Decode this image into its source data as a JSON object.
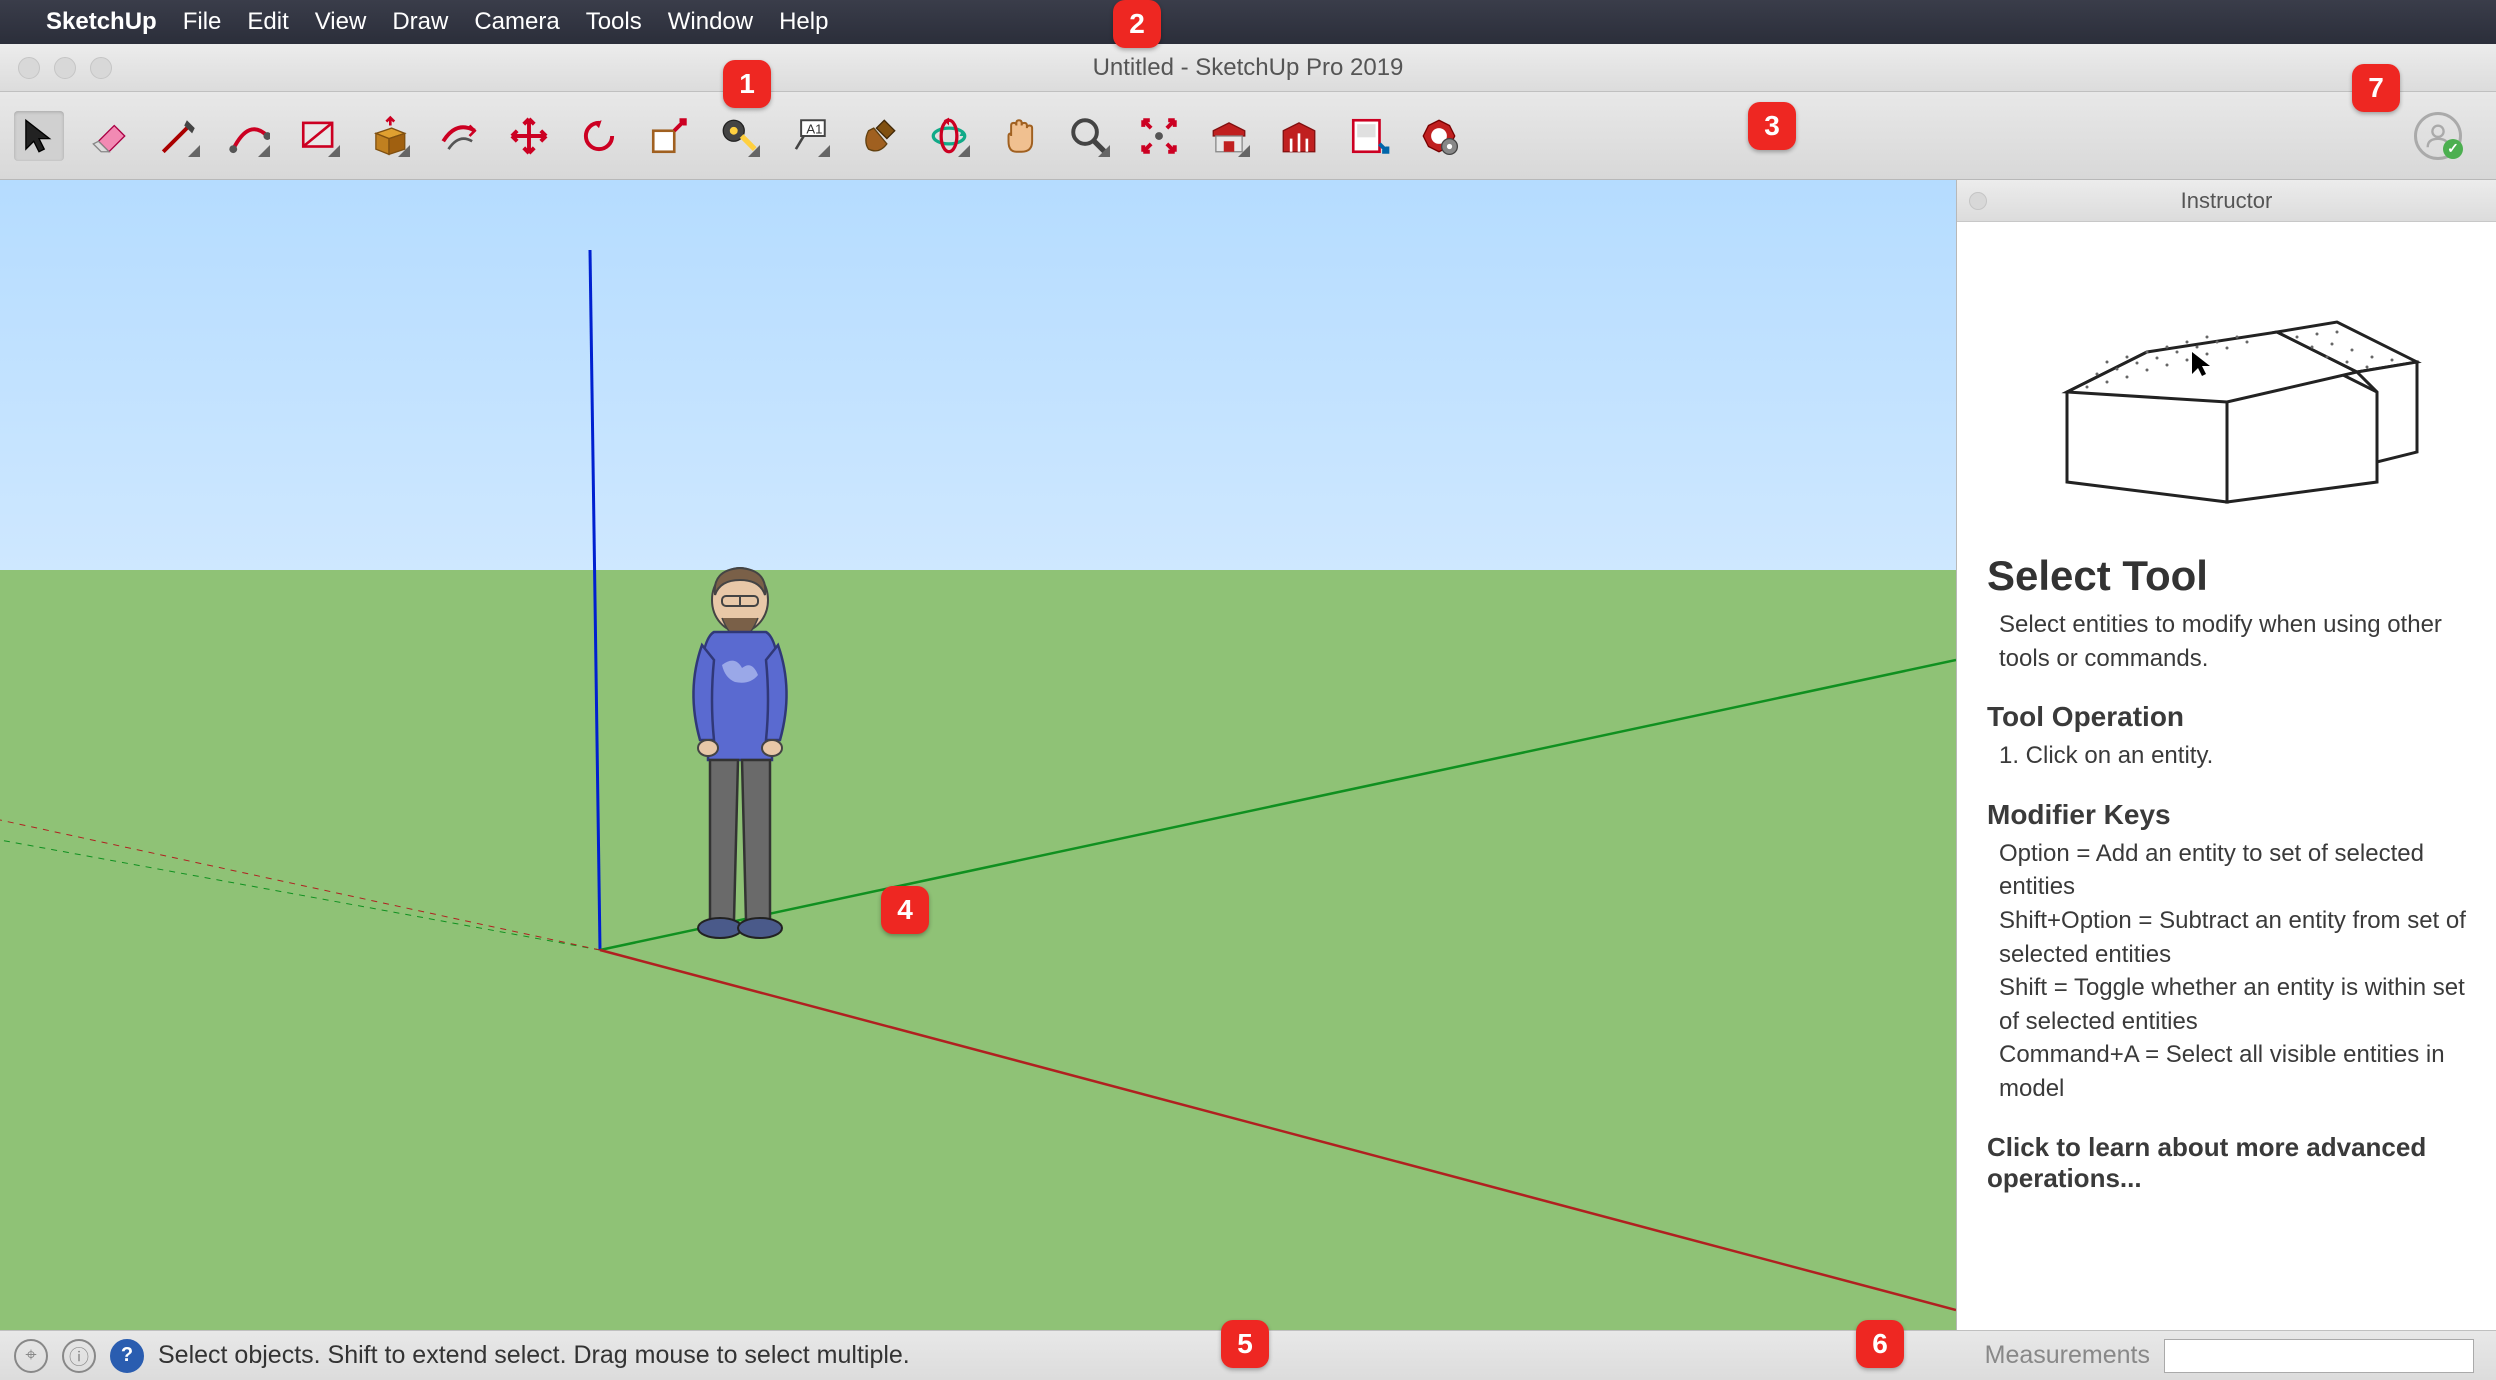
{
  "menubar": {
    "items": [
      "SketchUp",
      "File",
      "Edit",
      "View",
      "Draw",
      "Camera",
      "Tools",
      "Window",
      "Help"
    ]
  },
  "titlebar": {
    "title": "Untitled - SketchUp Pro 2019"
  },
  "toolbar": {
    "tools": [
      {
        "name": "select-tool",
        "active": true
      },
      {
        "name": "eraser-tool"
      },
      {
        "name": "line-tool",
        "dropdown": true
      },
      {
        "name": "arc-tool",
        "dropdown": true
      },
      {
        "name": "shape-tool",
        "dropdown": true
      },
      {
        "name": "pushpull-tool",
        "dropdown": true
      },
      {
        "name": "offset-tool"
      },
      {
        "name": "move-tool"
      },
      {
        "name": "rotate-tool"
      },
      {
        "name": "scale-tool"
      },
      {
        "name": "tape-tool",
        "dropdown": true
      },
      {
        "name": "text-tool",
        "dropdown": true
      },
      {
        "name": "paint-tool"
      },
      {
        "name": "orbit-tool",
        "dropdown": true
      },
      {
        "name": "pan-tool"
      },
      {
        "name": "zoom-tool",
        "dropdown": true
      },
      {
        "name": "zoom-extents-tool"
      },
      {
        "name": "3d-warehouse-tool",
        "dropdown": true
      },
      {
        "name": "extension-warehouse-tool"
      },
      {
        "name": "layout-tool"
      },
      {
        "name": "extension-manager-tool"
      }
    ]
  },
  "callouts": [
    "1",
    "2",
    "3",
    "4",
    "5",
    "6",
    "7"
  ],
  "instructor": {
    "title": "Instructor",
    "tool_name": "Select Tool",
    "tool_desc": "Select entities to modify when using other tools or commands.",
    "op_heading": "Tool Operation",
    "op_text": "1. Click on an entity.",
    "mod_heading": "Modifier Keys",
    "mod_text": "Option = Add an entity to set of selected entities\nShift+Option = Subtract an entity from set of selected entities\nShift = Toggle whether an entity is within set of selected entities\nCommand+A = Select all visible entities in model",
    "more_link": "Click to learn about more advanced operations..."
  },
  "statusbar": {
    "hint": "Select objects. Shift to extend select. Drag mouse to select multiple.",
    "meas_label": "Measurements",
    "meas_value": ""
  }
}
